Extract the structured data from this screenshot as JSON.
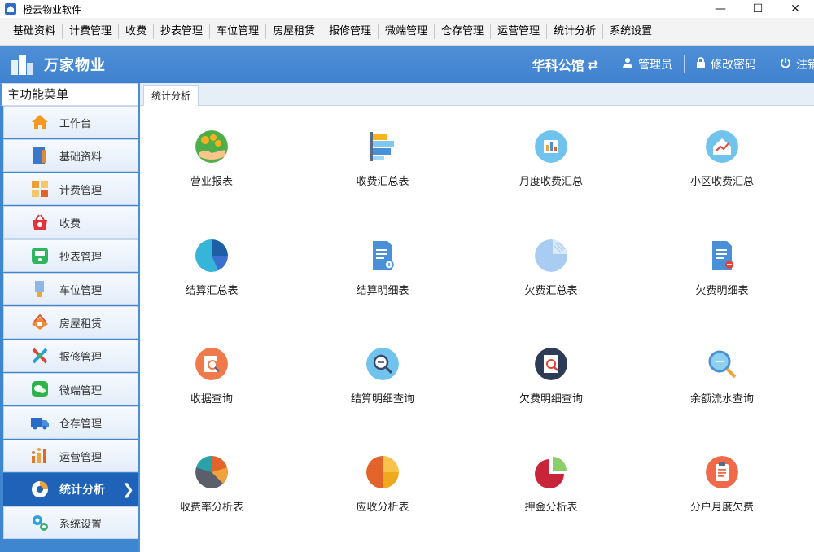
{
  "window": {
    "title": "橙云物业软件",
    "minimize": "—",
    "maximize": "☐",
    "close": "✕"
  },
  "menubar": [
    "基础资料",
    "计费管理",
    "收费",
    "抄表管理",
    "车位管理",
    "房屋租赁",
    "报修管理",
    "微端管理",
    "仓存管理",
    "运营管理",
    "统计分析",
    "系统设置"
  ],
  "header": {
    "brand": "万家物业",
    "complex": "华科公馆",
    "admin": "管理员",
    "change_password": "修改密码",
    "logout": "注销"
  },
  "sidebar": {
    "title": "主功能菜单",
    "items": [
      {
        "label": "工作台",
        "icon": "home-icon"
      },
      {
        "label": "基础资料",
        "icon": "book-icon"
      },
      {
        "label": "计费管理",
        "icon": "calculator-icon"
      },
      {
        "label": "收费",
        "icon": "basket-icon"
      },
      {
        "label": "抄表管理",
        "icon": "meter-icon"
      },
      {
        "label": "车位管理",
        "icon": "parking-icon"
      },
      {
        "label": "房屋租赁",
        "icon": "house-rent-icon"
      },
      {
        "label": "报修管理",
        "icon": "tools-icon"
      },
      {
        "label": "微端管理",
        "icon": "wechat-icon"
      },
      {
        "label": "仓存管理",
        "icon": "truck-icon"
      },
      {
        "label": "运营管理",
        "icon": "people-chart-icon"
      },
      {
        "label": "统计分析",
        "icon": "pie-chart-icon",
        "active": true
      },
      {
        "label": "系统设置",
        "icon": "gear-icon"
      }
    ]
  },
  "tabs": [
    {
      "label": "统计分析"
    }
  ],
  "tiles": [
    {
      "label": "营业报表",
      "icon": "business-report-icon"
    },
    {
      "label": "收费汇总表",
      "icon": "fee-summary-icon"
    },
    {
      "label": "月度收费汇总",
      "icon": "monthly-fee-icon"
    },
    {
      "label": "小区收费汇总",
      "icon": "community-fee-icon"
    },
    {
      "label": "结算汇总表",
      "icon": "settlement-summary-icon"
    },
    {
      "label": "结算明细表",
      "icon": "settlement-detail-icon"
    },
    {
      "label": "欠费汇总表",
      "icon": "arrears-summary-icon"
    },
    {
      "label": "欠费明细表",
      "icon": "arrears-detail-icon"
    },
    {
      "label": "收据查询",
      "icon": "receipt-search-icon"
    },
    {
      "label": "结算明细查询",
      "icon": "settlement-search-icon"
    },
    {
      "label": "欠费明细查询",
      "icon": "arrears-search-icon"
    },
    {
      "label": "余额流水查询",
      "icon": "balance-search-icon"
    },
    {
      "label": "收费率分析表",
      "icon": "rate-analysis-icon"
    },
    {
      "label": "应收分析表",
      "icon": "receivable-analysis-icon"
    },
    {
      "label": "押金分析表",
      "icon": "deposit-analysis-icon"
    },
    {
      "label": "分户月度欠费",
      "icon": "household-arrears-icon"
    }
  ]
}
